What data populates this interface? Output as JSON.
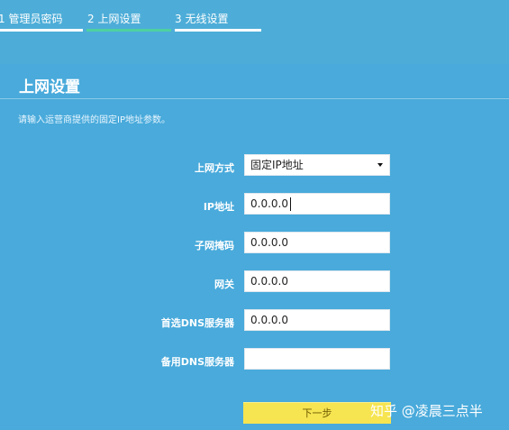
{
  "steps": [
    {
      "label": "1 管理员密码"
    },
    {
      "label": "2 上网设置"
    },
    {
      "label": "3 无线设置"
    }
  ],
  "section": {
    "title": "上网设置",
    "description": "请输入运营商提供的固定IP地址参数。"
  },
  "form": {
    "connection_type_label": "上网方式",
    "connection_type_value": "固定IP地址",
    "ip_label": "IP地址",
    "ip_value": "0.0.0.0",
    "mask_label": "子网掩码",
    "mask_value": "0.0.0.0",
    "gateway_label": "网关",
    "gateway_value": "0.0.0.0",
    "dns1_label": "首选DNS服务器",
    "dns1_value": "0.0.0.0",
    "dns2_label": "备用DNS服务器",
    "dns2_value": "",
    "next_label": "下一步"
  },
  "watermark": "知乎 @凌晨三点半",
  "colors": {
    "background": "#4dadd8",
    "active_step": "#4fd0a0",
    "button": "#f6e451"
  }
}
